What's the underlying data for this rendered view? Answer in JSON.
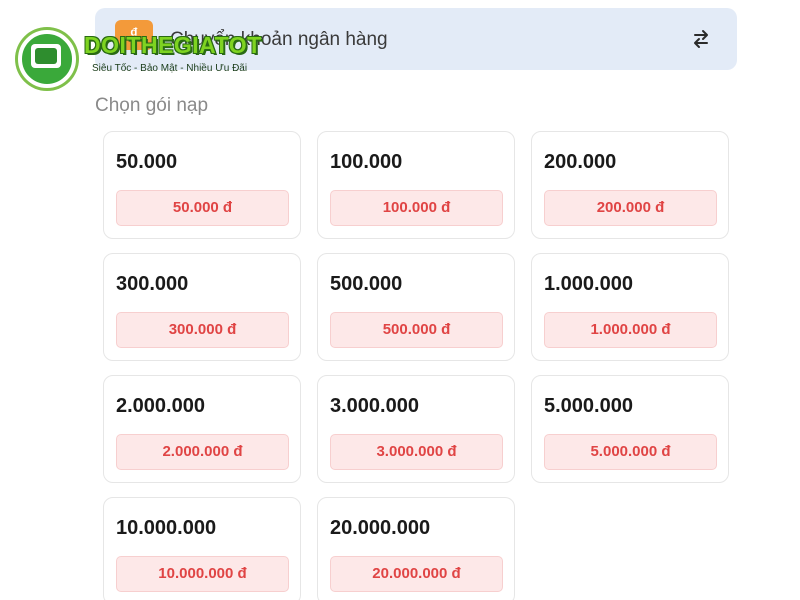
{
  "payment_method": {
    "label": "Chuyển khoản ngân hàng",
    "icon": "transfer-icon",
    "accent": "#f39a3a"
  },
  "logo": {
    "title": "DOITHEGIATOT",
    "subtitle": "Siêu Tốc - Bảo Mật - Nhiều Ưu Đãi"
  },
  "section_title": "Chọn gói nạp",
  "packages": [
    {
      "amount": "50.000",
      "price": "50.000 đ"
    },
    {
      "amount": "100.000",
      "price": "100.000 đ"
    },
    {
      "amount": "200.000",
      "price": "200.000 đ"
    },
    {
      "amount": "300.000",
      "price": "300.000 đ"
    },
    {
      "amount": "500.000",
      "price": "500.000 đ"
    },
    {
      "amount": "1.000.000",
      "price": "1.000.000 đ"
    },
    {
      "amount": "2.000.000",
      "price": "2.000.000 đ"
    },
    {
      "amount": "3.000.000",
      "price": "3.000.000 đ"
    },
    {
      "amount": "5.000.000",
      "price": "5.000.000 đ"
    },
    {
      "amount": "10.000.000",
      "price": "10.000.000 đ"
    },
    {
      "amount": "20.000.000",
      "price": "20.000.000 đ"
    }
  ],
  "colors": {
    "price_text": "#e04444",
    "price_bg": "#fde8e8",
    "method_bg": "#e3ebf7",
    "logo_green": "#7ed321"
  }
}
